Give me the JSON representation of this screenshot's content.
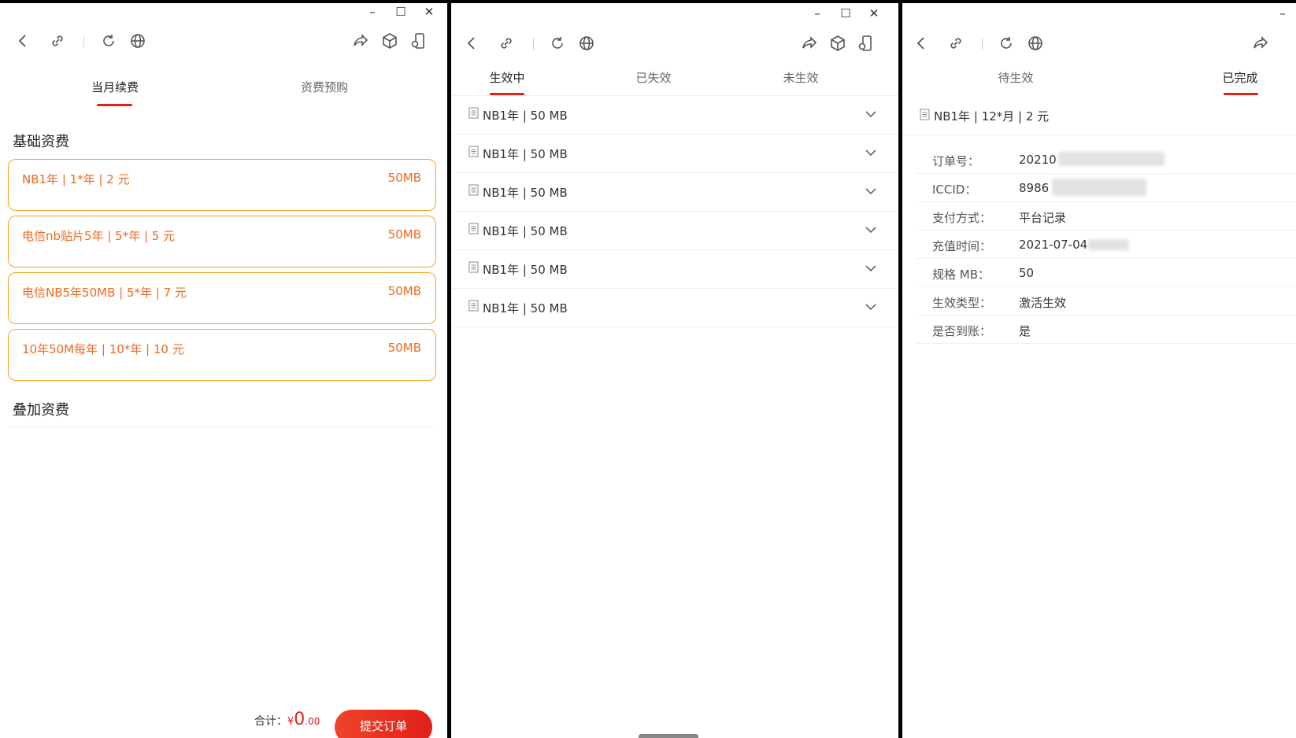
{
  "window_controls": {
    "minimize": "–",
    "maximize": "☐",
    "close": "✕"
  },
  "icons": {
    "back": "back-icon",
    "link": "link-icon",
    "refresh": "refresh-icon",
    "globe": "globe-icon",
    "share": "share-icon",
    "cube": "cube-icon",
    "phone_settings": "phone-settings-icon",
    "document": "document-icon",
    "chevron": "chevron-down-icon"
  },
  "colors": {
    "accent_red": "#e0201b",
    "card_border": "#f5a623",
    "card_text": "#f06a20"
  },
  "panel1": {
    "tabs": [
      {
        "label": "当月续费",
        "active": true
      },
      {
        "label": "资费预购",
        "active": false
      }
    ],
    "basic_title": "基础资费",
    "cards": [
      {
        "name": "NB1年 | 1*年 | 2 元",
        "spec": "50MB"
      },
      {
        "name": "电信nb贴片5年 | 5*年 | 5 元",
        "spec": "50MB"
      },
      {
        "name": "电信NB5年50MB | 5*年 | 7 元",
        "spec": "50MB"
      },
      {
        "name": "10年50M每年 | 10*年 | 10 元",
        "spec": "50MB"
      }
    ],
    "addon_title": "叠加资费",
    "footer": {
      "total_label": "合计：",
      "currency": "¥",
      "amount": "0",
      "decimals": ".00",
      "submit_label": "提交订单"
    }
  },
  "panel2": {
    "tabs": [
      {
        "label": "生效中",
        "active": true
      },
      {
        "label": "已失效",
        "active": false
      },
      {
        "label": "未生效",
        "active": false
      }
    ],
    "rows": [
      "NB1年 | 50 MB",
      "NB1年 | 50 MB",
      "NB1年 | 50 MB",
      "NB1年 | 50 MB",
      "NB1年 | 50 MB",
      "NB1年 | 50 MB"
    ]
  },
  "panel3": {
    "tabs": [
      {
        "label": "待生效",
        "active": false
      },
      {
        "label": "已完成",
        "active": true
      }
    ],
    "header": "NB1年 | 12*月 | 2 元",
    "details": [
      {
        "key": "订单号：",
        "value": "20210"
      },
      {
        "key": "ICCID：",
        "value": "8986"
      },
      {
        "key": "支付方式：",
        "value": "平台记录"
      },
      {
        "key": "充值时间：",
        "value": "2021-07-04"
      },
      {
        "key": "规格 MB：",
        "value": "50"
      },
      {
        "key": "生效类型：",
        "value": "激活生效"
      },
      {
        "key": "是否到账：",
        "value": "是"
      }
    ]
  }
}
